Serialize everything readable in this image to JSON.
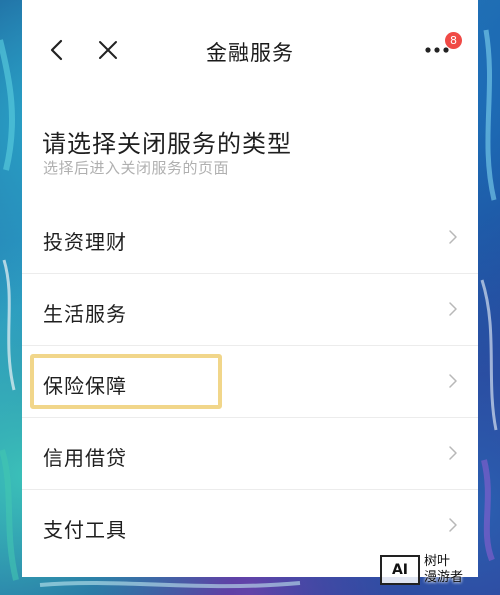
{
  "header": {
    "title": "金融服务",
    "badge_count": "8",
    "back_icon": "back-chevron-icon",
    "close_icon": "close-icon",
    "more_icon": "more-dots-icon"
  },
  "section": {
    "title": "请选择关闭服务的类型",
    "subtitle": "选择后进入关闭服务的页面"
  },
  "menu": {
    "items": [
      {
        "label": "投资理财"
      },
      {
        "label": "生活服务"
      },
      {
        "label": "保险保障",
        "highlighted": true
      },
      {
        "label": "信用借贷"
      },
      {
        "label": "支付工具"
      }
    ]
  },
  "watermark": {
    "logo": "AI",
    "line1": "树叶",
    "line2": "漫游者"
  },
  "colors": {
    "badge": "#f04a46",
    "highlight_border": "#f1d68a",
    "subtitle": "#b0b0b0"
  }
}
